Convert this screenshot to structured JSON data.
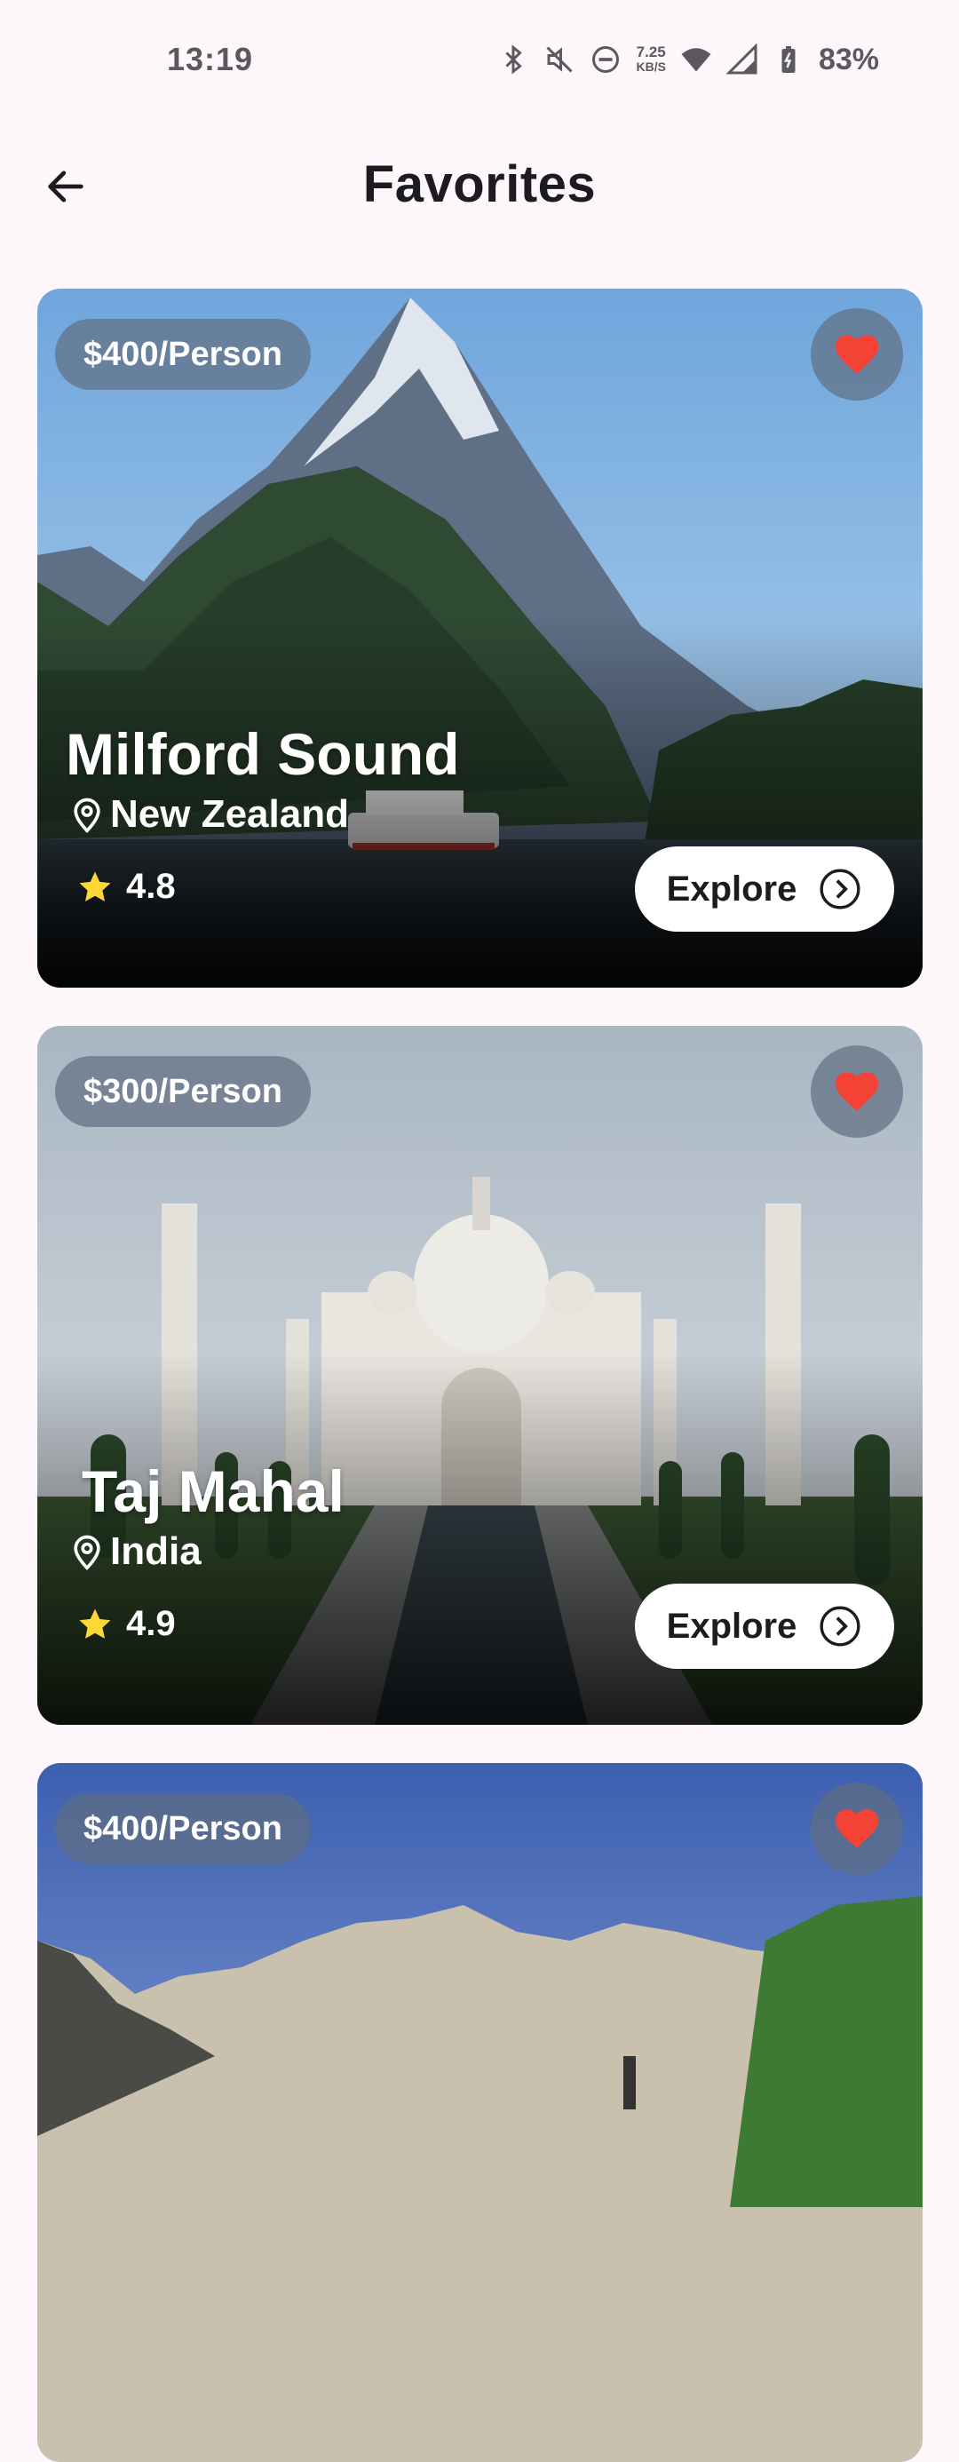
{
  "status_bar": {
    "time": "13:19",
    "net_speed_value": "7.25",
    "net_speed_unit": "KB/S",
    "battery": "83%",
    "icons": [
      "bluetooth-icon",
      "mute-icon",
      "dnd-icon",
      "wifi-icon",
      "signal-icon",
      "battery-icon"
    ]
  },
  "header": {
    "title": "Favorites",
    "back_icon": "arrow-left-icon"
  },
  "cards": [
    {
      "price": "$400/Person",
      "name": "Milford Sound",
      "location": "New Zealand",
      "rating": "4.8",
      "explore_label": "Explore"
    },
    {
      "price": "$300/Person",
      "name": "Taj Mahal",
      "location": "India",
      "rating": "4.9",
      "explore_label": "Explore"
    },
    {
      "price": "$400/Person"
    }
  ],
  "colors": {
    "background": "#fdf6fb",
    "heart": "#f44336",
    "star": "#fdd835",
    "badge": "#5f6e82"
  }
}
